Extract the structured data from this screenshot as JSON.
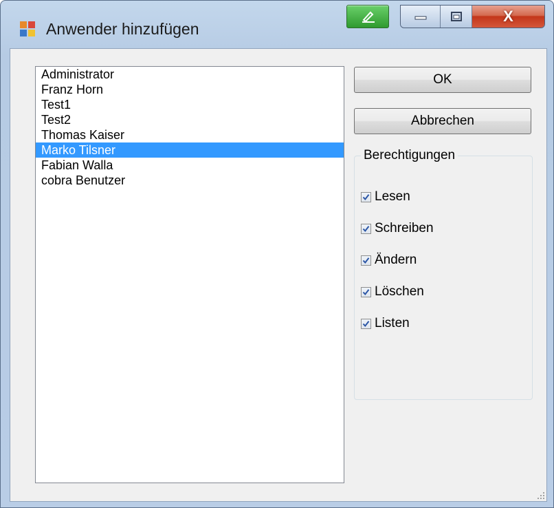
{
  "window": {
    "title": "Anwender hinzufügen",
    "close_glyph": "X"
  },
  "users": {
    "items": [
      "Administrator",
      "Franz Horn",
      "Test1",
      "Test2",
      "Thomas Kaiser",
      "Marko Tilsner",
      "Fabian Walla",
      "cobra Benutzer"
    ],
    "selected_index": 5
  },
  "buttons": {
    "ok": "OK",
    "cancel": "Abbrechen"
  },
  "permissions": {
    "title": "Berechtigungen",
    "items": [
      {
        "label": "Lesen",
        "checked": true
      },
      {
        "label": "Schreiben",
        "checked": true
      },
      {
        "label": "Ändern",
        "checked": true
      },
      {
        "label": "Löschen",
        "checked": true
      },
      {
        "label": "Listen",
        "checked": true
      }
    ]
  },
  "colors": {
    "selection": "#3399ff",
    "close_button": "#c3361a",
    "check": "#2a55a5"
  },
  "icons": {
    "app": "app-window-icon",
    "pen": "pen-icon",
    "minimize": "minimize-icon",
    "maximize": "maximize-icon",
    "close": "close-icon",
    "check": "checkmark-icon"
  }
}
